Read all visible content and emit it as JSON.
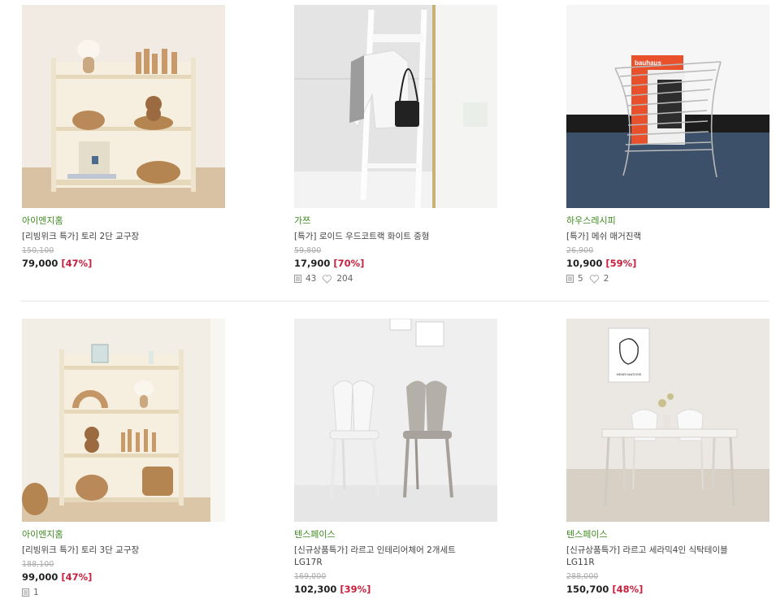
{
  "products": [
    {
      "brand": "아이엔지홈",
      "name": "[리빙위크 특가] 토리 2단 교구장",
      "original_price": "150,100",
      "price": "79,000",
      "discount": "[47%]",
      "reviews": "",
      "likes": ""
    },
    {
      "brand": "가쯔",
      "name": "[특가] 로이드 우드코트랙 화이트 중형",
      "original_price": "59,800",
      "price": "17,900",
      "discount": "[70%]",
      "reviews": "43",
      "likes": "204"
    },
    {
      "brand": "하우스레시피",
      "name": "[특가] 메쉬 매거진랙",
      "original_price": "26,900",
      "price": "10,900",
      "discount": "[59%]",
      "reviews": "5",
      "likes": "2"
    },
    {
      "brand": "아이엔지홈",
      "name": "[리빙위크 특가] 토리 3단 교구장",
      "original_price": "188,100",
      "price": "99,000",
      "discount": "[47%]",
      "reviews": "1",
      "likes": ""
    },
    {
      "brand": "텐스페이스",
      "name": "[신규상품특가] 라르고 인테리어체어 2개세트\nLG17R",
      "original_price": "169,000",
      "price": "102,300",
      "discount": "[39%]",
      "reviews": "",
      "likes": ""
    },
    {
      "brand": "텐스페이스",
      "name": "[신규상품특가] 라르고 세라믹4인 식탁테이블\nLG11R",
      "original_price": "288,000",
      "price": "150,700",
      "discount": "[48%]",
      "reviews": "",
      "likes": ""
    }
  ],
  "magazine": {
    "title": "bauhaus"
  },
  "poster": {
    "caption": "HENRI MATISSE"
  }
}
